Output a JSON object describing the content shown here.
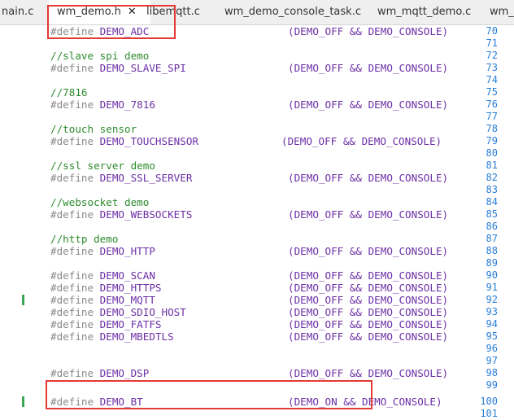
{
  "tabs": [
    {
      "label": "nain.c",
      "active": false
    },
    {
      "label": "wm_demo.h",
      "active": true,
      "close": "✕"
    },
    {
      "label": "libemqtt.c",
      "active": false
    },
    {
      "label": "wm_demo_console_task.c",
      "active": false
    },
    {
      "label": "wm_mqtt_demo.c",
      "active": false
    },
    {
      "label": "wm_",
      "active": false
    }
  ],
  "lines": [
    {
      "n": "70",
      "kind": "define",
      "kw": "#define",
      "name": "DEMO_ADC",
      "value": "(DEMO_OFF && DEMO_CONSOLE)"
    },
    {
      "n": "71",
      "kind": "blank"
    },
    {
      "n": "72",
      "kind": "comment",
      "text": "//slave spi demo"
    },
    {
      "n": "73",
      "kind": "define",
      "kw": "#define",
      "name": "DEMO_SLAVE_SPI",
      "value": "(DEMO_OFF && DEMO_CONSOLE)"
    },
    {
      "n": "74",
      "kind": "blank"
    },
    {
      "n": "75",
      "kind": "comment",
      "text": "//7816"
    },
    {
      "n": "76",
      "kind": "define",
      "kw": "#define",
      "name": "DEMO_7816",
      "value": "(DEMO_OFF && DEMO_CONSOLE)"
    },
    {
      "n": "77",
      "kind": "blank"
    },
    {
      "n": "78",
      "kind": "comment",
      "text": "//touch sensor"
    },
    {
      "n": "79",
      "kind": "define",
      "kw": "#define",
      "name": "DEMO_TOUCHSENSOR",
      "value": "(DEMO_OFF && DEMO_CONSOLE)",
      "shift": true
    },
    {
      "n": "80",
      "kind": "blank"
    },
    {
      "n": "81",
      "kind": "comment",
      "text": "//ssl server demo"
    },
    {
      "n": "82",
      "kind": "define",
      "kw": "#define",
      "name": "DEMO_SSL_SERVER",
      "value": "(DEMO_OFF && DEMO_CONSOLE)"
    },
    {
      "n": "83",
      "kind": "blank"
    },
    {
      "n": "84",
      "kind": "comment",
      "text": "//websocket demo"
    },
    {
      "n": "85",
      "kind": "define",
      "kw": "#define",
      "name": "DEMO_WEBSOCKETS",
      "value": "(DEMO_OFF && DEMO_CONSOLE)"
    },
    {
      "n": "86",
      "kind": "blank"
    },
    {
      "n": "87",
      "kind": "comment",
      "text": "//http demo"
    },
    {
      "n": "88",
      "kind": "define",
      "kw": "#define",
      "name": "DEMO_HTTP",
      "value": "(DEMO_OFF && DEMO_CONSOLE)"
    },
    {
      "n": "89",
      "kind": "blank"
    },
    {
      "n": "90",
      "kind": "define",
      "kw": "#define",
      "name": "DEMO_SCAN",
      "value": "(DEMO_OFF && DEMO_CONSOLE)"
    },
    {
      "n": "91",
      "kind": "define",
      "kw": "#define",
      "name": "DEMO_HTTPS",
      "value": "(DEMO_OFF && DEMO_CONSOLE)"
    },
    {
      "n": "92",
      "kind": "define",
      "kw": "#define",
      "name": "DEMO_MQTT",
      "value": "(DEMO_OFF && DEMO_CONSOLE)",
      "changed": true
    },
    {
      "n": "93",
      "kind": "define",
      "kw": "#define",
      "name": "DEMO_SDIO_HOST",
      "value": "(DEMO_OFF && DEMO_CONSOLE)"
    },
    {
      "n": "94",
      "kind": "define",
      "kw": "#define",
      "name": "DEMO_FATFS",
      "value": "(DEMO_OFF && DEMO_CONSOLE)"
    },
    {
      "n": "95",
      "kind": "define",
      "kw": "#define",
      "name": "DEMO_MBEDTLS",
      "value": "(DEMO_OFF && DEMO_CONSOLE)"
    },
    {
      "n": "96",
      "kind": "blank"
    },
    {
      "n": "97",
      "kind": "blank"
    },
    {
      "n": "98",
      "kind": "define",
      "kw": "#define",
      "name": "DEMO_DSP",
      "value": "(DEMO_OFF && DEMO_CONSOLE)"
    },
    {
      "n": "99",
      "kind": "blank"
    },
    {
      "n": "100",
      "kind": "define",
      "kw": "#define",
      "name": "DEMO_BT",
      "value": "(DEMO_ON && DEMO_CONSOLE)",
      "changed": true
    },
    {
      "n": "101",
      "kind": "blank"
    }
  ],
  "colors": {
    "highlight": "#e53935",
    "line_number": "#2b7ed8",
    "comment": "#2e8b2e",
    "macro": "#6c2fa6",
    "change_marker": "#3aa655"
  }
}
